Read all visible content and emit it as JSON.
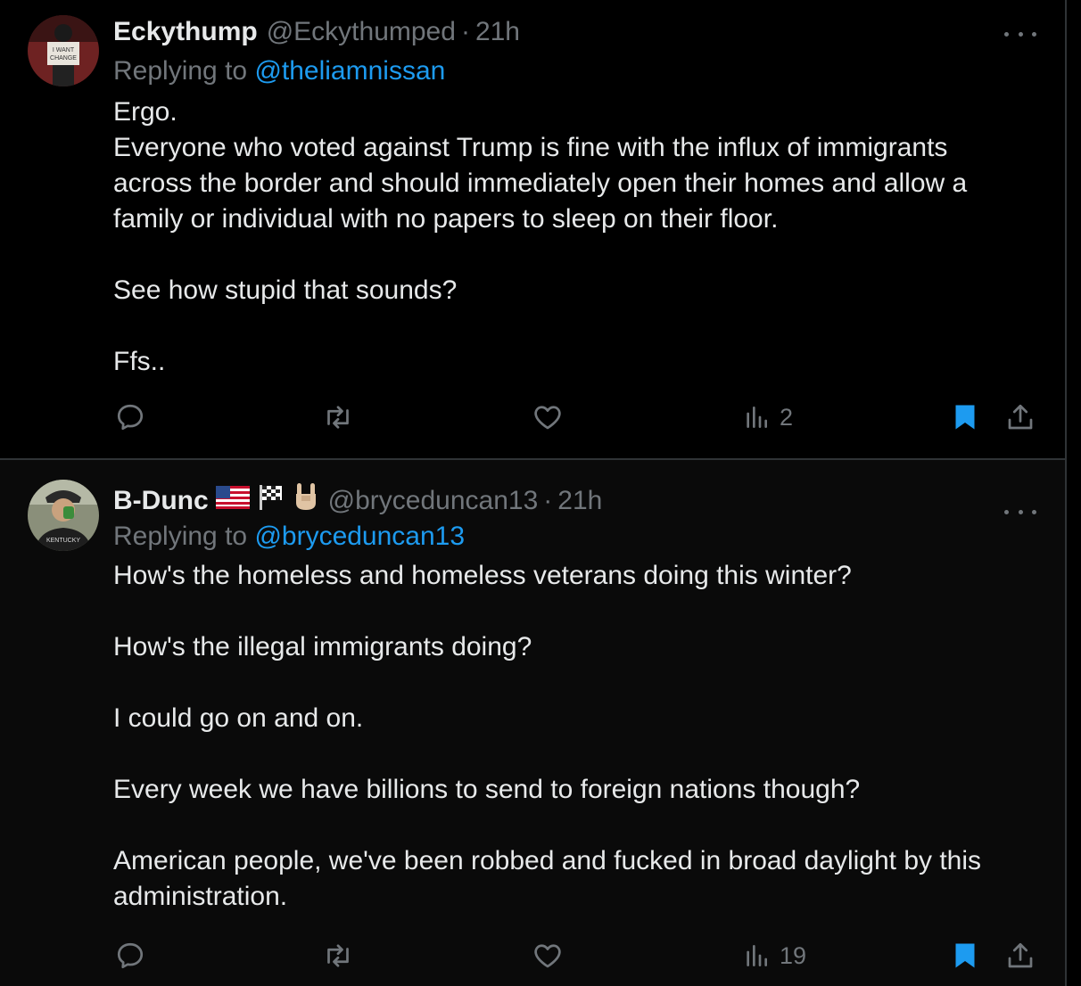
{
  "tweets": [
    {
      "author": {
        "name": "Eckythump",
        "handle": "@Eckythumped"
      },
      "time": "21h",
      "reply_label": "Replying to",
      "reply_to": "@theliamnissan",
      "body": [
        "Ergo.",
        "Everyone who voted against Trump is fine with the influx of immigrants across the border and should immediately open their homes and allow a family or individual with no papers to sleep on their floor.",
        "",
        "See how stupid that sounds?",
        "",
        "Ffs.."
      ],
      "views": "2",
      "avatar_text": [
        "I WANT",
        "CHANGE"
      ],
      "bookmarked": true
    },
    {
      "author": {
        "name": "B-Dunc",
        "handle": "@bryceduncan13"
      },
      "time": "21h",
      "reply_label": "Replying to",
      "reply_to": "@bryceduncan13",
      "body": [
        "How's the homeless and homeless veterans doing this winter?",
        "",
        "How's the illegal immigrants doing?",
        "",
        "I could go on and on.",
        "",
        "Every week we have billions to send to foreign nations though?",
        "",
        "American people, we've been robbed and fucked in broad daylight by this administration."
      ],
      "views": "19",
      "avatar_text": [
        "KENTUCKY"
      ],
      "name_emojis": [
        "us-flag-icon",
        "checkered-flag-icon",
        "rock-hand-icon"
      ],
      "bookmarked": true
    }
  ],
  "colors": {
    "background": "#000000",
    "text": "#e7e9ea",
    "muted": "#71767b",
    "accent": "#1d9bf0",
    "border": "#2f3336"
  }
}
